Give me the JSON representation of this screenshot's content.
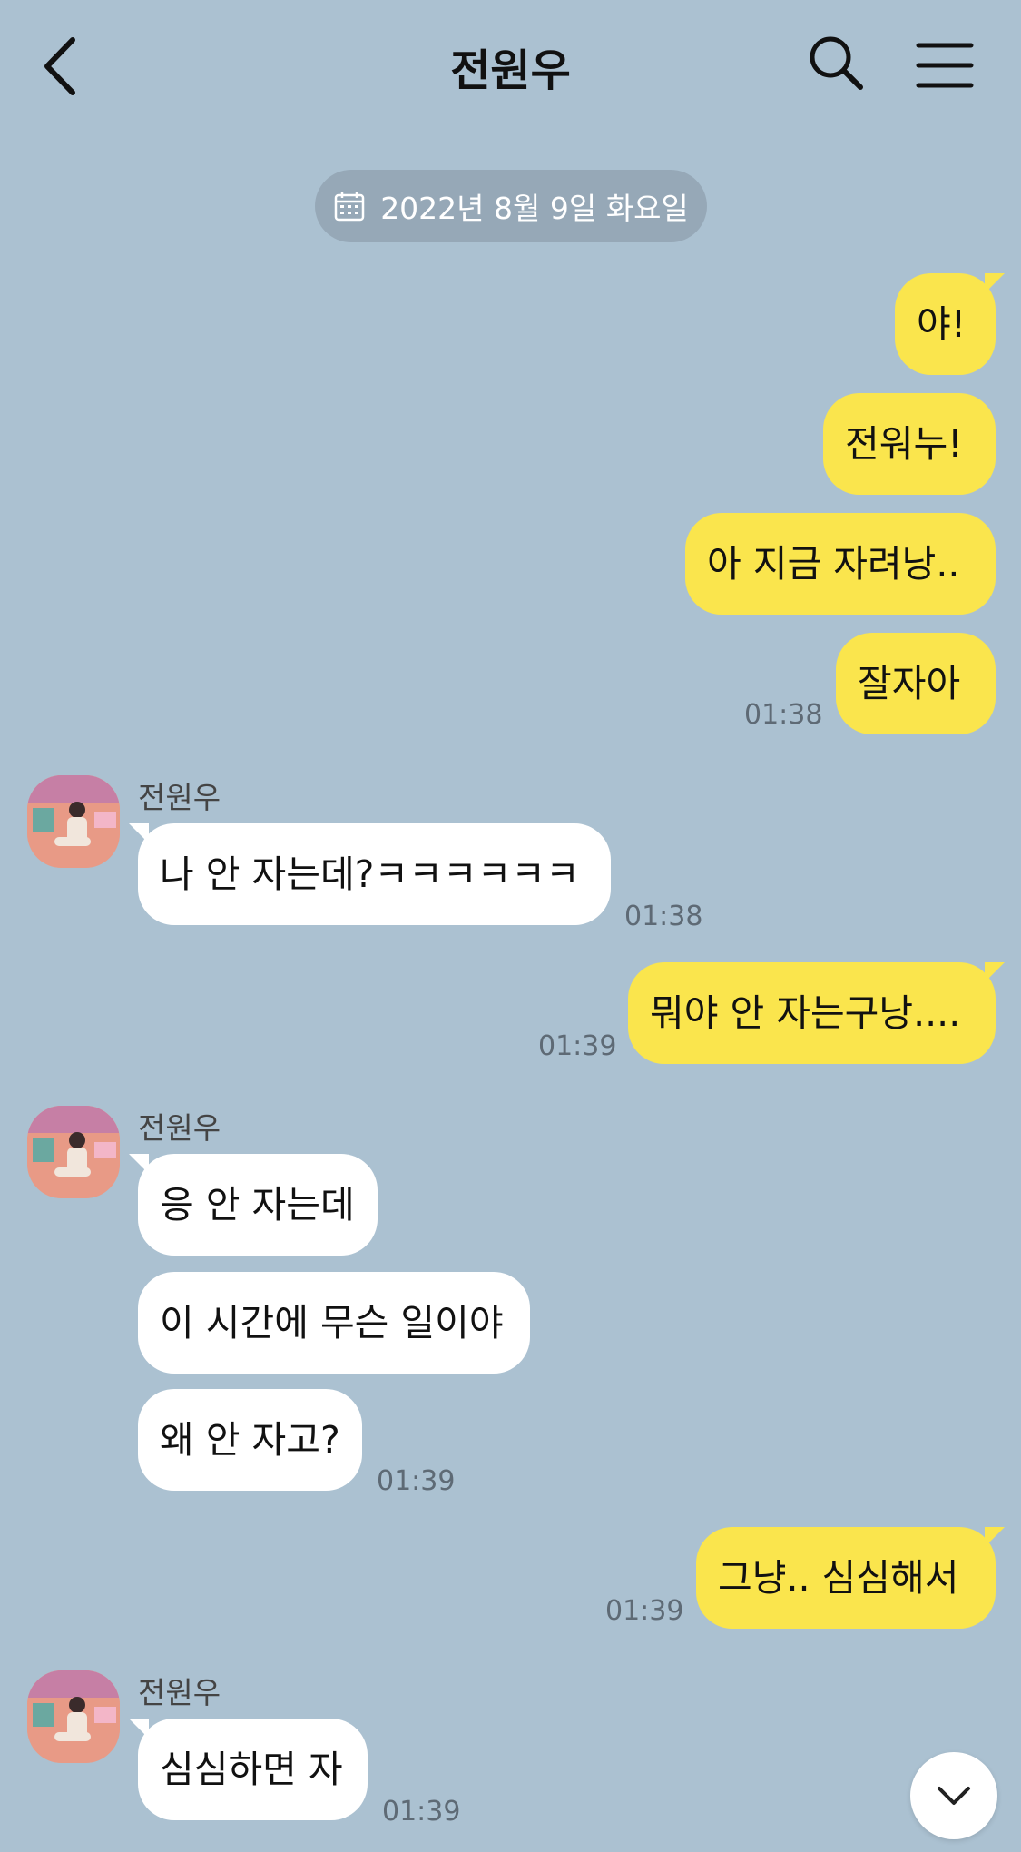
{
  "header": {
    "title": "전원우"
  },
  "date_divider": "2022년 8월 9일 화요일",
  "messages": {
    "m1": {
      "text": "야!"
    },
    "m2": {
      "text": "전워누!"
    },
    "m3": {
      "text": "아 지금 자려낭.."
    },
    "m4": {
      "text": "잘자아",
      "time": "01:38"
    },
    "m5": {
      "sender": "전원우",
      "text": "나 안 자는데?ㅋㅋㅋㅋㅋㅋ",
      "time": "01:38"
    },
    "m6": {
      "text": "뭐야 안 자는구낭....",
      "time": "01:39"
    },
    "m7": {
      "sender": "전원우",
      "text": "응 안 자는데"
    },
    "m8": {
      "text": "이 시간에 무슨 일이야"
    },
    "m9": {
      "text": "왜 안 자고?",
      "time": "01:39"
    },
    "m10": {
      "text": "그냥.. 심심해서",
      "time": "01:39"
    },
    "m11": {
      "sender": "전원우",
      "text": "심심하면 자",
      "time": "01:39"
    }
  },
  "icons": {
    "back": "chevron-left-icon",
    "search": "search-icon",
    "menu": "hamburger-menu-icon",
    "calendar": "calendar-icon",
    "scroll": "chevron-down-icon"
  },
  "colors": {
    "background": "#abc1d1",
    "my_bubble": "#fae54d",
    "their_bubble": "#ffffff",
    "date_pill": "#96a8b7"
  }
}
